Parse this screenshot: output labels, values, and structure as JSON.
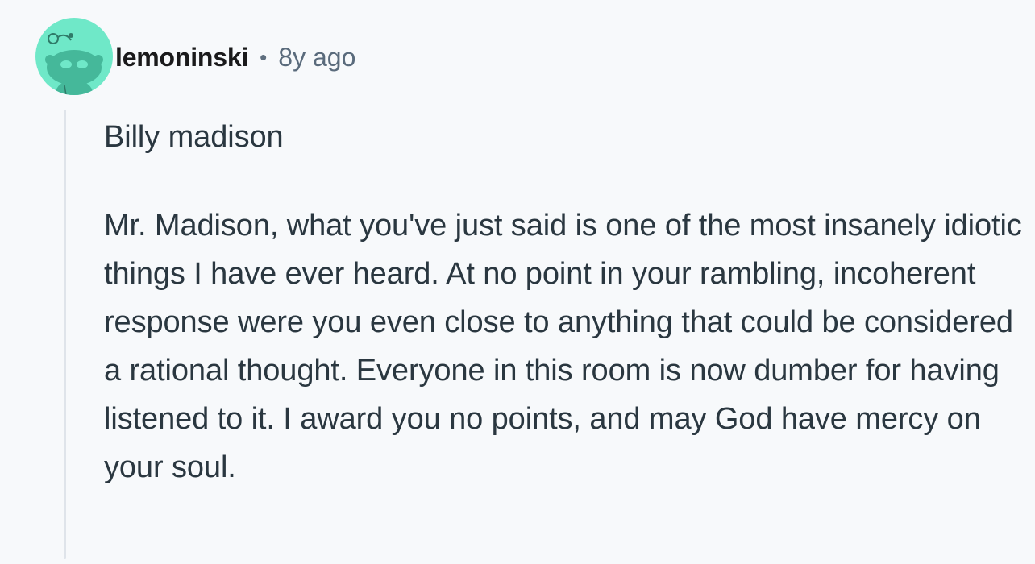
{
  "comment": {
    "author": "lemoninski",
    "separator": "•",
    "age": "8y ago",
    "avatar_icon": "snoo-avatar-icon",
    "avatar_color": "#6fe8c8",
    "paragraphs": [
      "Billy madison",
      "Mr. Madison, what you've just said is one of the most insanely idiotic things I have ever heard. At no point in your rambling, incoherent response were you even close to anything that could be considered a rational thought. Everyone in this room is now dumber for having listened to it. I award you no points, and may God have mercy on your soul."
    ]
  }
}
